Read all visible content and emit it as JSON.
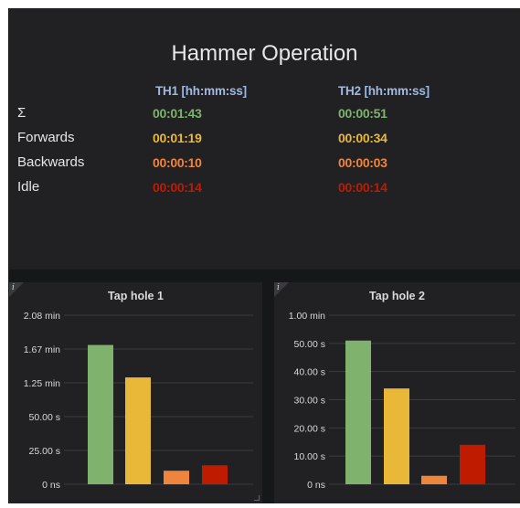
{
  "top_panel": {
    "title": "Hammer Operation",
    "columns": [
      "TH1 [hh:mm:ss]",
      "TH2 [hh:mm:ss]"
    ],
    "rows": [
      {
        "label": "Σ",
        "th1": "00:01:43",
        "th2": "00:00:51",
        "color": "#7eb26d"
      },
      {
        "label": "Forwards",
        "th1": "00:01:19",
        "th2": "00:00:34",
        "color": "#eab839"
      },
      {
        "label": "Backwards",
        "th1": "00:00:10",
        "th2": "00:00:03",
        "color": "#ef843c"
      },
      {
        "label": "Idle",
        "th1": "00:00:14",
        "th2": "00:00:14",
        "color": "#bf1b00"
      }
    ]
  },
  "charts": [
    {
      "title": "Tap hole 1",
      "info_icon": "info-icon"
    },
    {
      "title": "Tap hole 2",
      "info_icon": "info-icon"
    }
  ],
  "chart_data": [
    {
      "type": "bar",
      "title": "Tap hole 1",
      "categories": [
        "Σ",
        "Forwards",
        "Backwards",
        "Idle"
      ],
      "values": [
        103,
        79,
        10,
        14
      ],
      "colors": [
        "#7eb26d",
        "#eab839",
        "#ef843c",
        "#bf1b00"
      ],
      "y_ticks": [
        {
          "value": 0,
          "label": "0 ns"
        },
        {
          "value": 25,
          "label": "25.00 s"
        },
        {
          "value": 50,
          "label": "50.00 s"
        },
        {
          "value": 75,
          "label": "1.25 min"
        },
        {
          "value": 100,
          "label": "1.67 min"
        },
        {
          "value": 125,
          "label": "2.08 min"
        }
      ],
      "ylim": [
        0,
        125
      ],
      "grid": true
    },
    {
      "type": "bar",
      "title": "Tap hole 2",
      "categories": [
        "Σ",
        "Forwards",
        "Backwards",
        "Idle"
      ],
      "values": [
        51,
        34,
        3,
        14
      ],
      "colors": [
        "#7eb26d",
        "#eab839",
        "#ef843c",
        "#bf1b00"
      ],
      "y_ticks": [
        {
          "value": 0,
          "label": "0 ns"
        },
        {
          "value": 10,
          "label": "10.00 s"
        },
        {
          "value": 20,
          "label": "20.00 s"
        },
        {
          "value": 30,
          "label": "30.00 s"
        },
        {
          "value": 40,
          "label": "40.00 s"
        },
        {
          "value": 50,
          "label": "50.00 s"
        },
        {
          "value": 60,
          "label": "1.00 min"
        }
      ],
      "ylim": [
        0,
        60
      ],
      "grid": true
    }
  ]
}
